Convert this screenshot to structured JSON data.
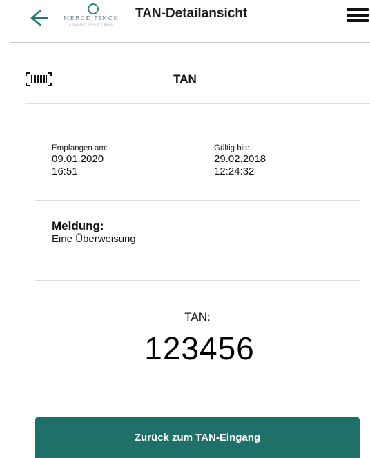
{
  "header": {
    "title": "TAN-Detailansicht",
    "logo_name": "MERCK FINCK",
    "logo_sub": "A QUINTET PRIVATE BANK",
    "back_icon": "arrow-left-icon",
    "menu_icon": "hamburger-menu-icon"
  },
  "section": {
    "title": "TAN",
    "icon": "barcode-scan-icon"
  },
  "details": {
    "received_label": "Empfangen am:",
    "received_date": "09.01.2020",
    "received_time": "16:51",
    "valid_label": "Gültig bis:",
    "valid_date": "29.02.2018",
    "valid_time": "12:24:32"
  },
  "message": {
    "label": "Meldung:",
    "text": "Eine Überweisung"
  },
  "tan": {
    "label": "TAN:",
    "value": "123456"
  },
  "actions": {
    "back_label": "Zurück zum TAN-Eingang"
  },
  "colors": {
    "accent": "#1f7068",
    "back_arrow": "#1e7a70",
    "divider": "#dcdfe1"
  }
}
